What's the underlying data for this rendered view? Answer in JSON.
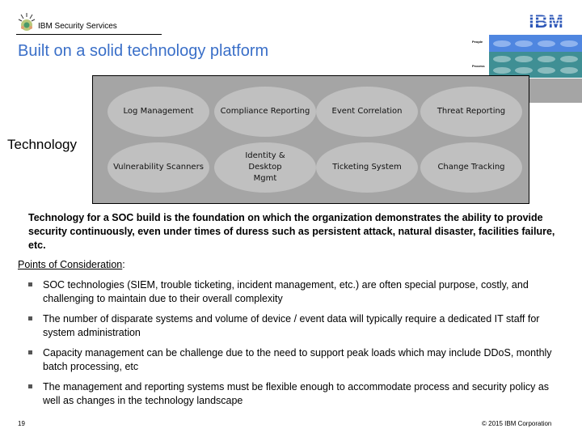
{
  "header": {
    "brand": "IBM Security Services",
    "logo_text": "IBM"
  },
  "title": "Built on a solid technology platform",
  "mini_diagram": {
    "labels": [
      "People",
      "Process"
    ],
    "colors": {
      "people": "#4f86e0",
      "process": "#3f8f94",
      "technology": "#a5a5a5"
    }
  },
  "diagram": {
    "side_label": "Technology",
    "items": [
      "Log Management",
      "Compliance Reporting",
      "Event Correlation",
      "Threat Reporting",
      "Vulnerability Scanners",
      "Identity & Desktop Mgmt",
      "Ticketing System",
      "Change Tracking"
    ]
  },
  "intro": "Technology for a SOC build is the foundation on which the organization demonstrates the ability to provide security continuously, even under times of duress such as persistent attack, natural disaster, facilities failure, etc.",
  "points_heading": "Points of Consideration",
  "points_suffix": ":",
  "bullets": [
    "SOC technologies (SIEM, trouble ticketing, incident management, etc.) are often special purpose, costly, and challenging to maintain due to their overall complexity",
    "The number of disparate systems and volume of device / event data will typically require a dedicated IT staff for system administration",
    "Capacity management can be challenge due to the need to support peak loads which may include DDoS, monthly batch processing, etc",
    "The management and reporting systems must be flexible enough to accommodate process and security policy as well as changes in the technology landscape"
  ],
  "footer": {
    "page": "19",
    "copyright": "© 2015 IBM Corporation"
  }
}
